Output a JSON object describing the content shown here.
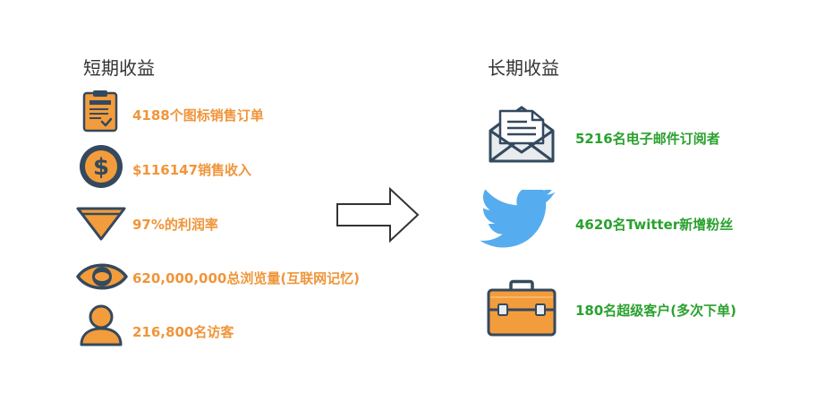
{
  "short_term": {
    "heading": "短期收益",
    "items": [
      {
        "icon": "clipboard-icon",
        "text": "4188个图标销售订单"
      },
      {
        "icon": "dollar-coin-icon",
        "text": "$116147销售收入"
      },
      {
        "icon": "triangle-icon",
        "text": "97%的利润率"
      },
      {
        "icon": "eye-icon",
        "text": "620,000,000总浏览量(互联网记忆)"
      },
      {
        "icon": "user-icon",
        "text": "216,800名访客"
      }
    ]
  },
  "long_term": {
    "heading": "长期收益",
    "items": [
      {
        "icon": "envelope-icon",
        "text": "5216名电子邮件订阅者"
      },
      {
        "icon": "twitter-bird-icon",
        "text": "4620名Twitter新增粉丝"
      },
      {
        "icon": "briefcase-icon",
        "text": "180名超级客户(多次下单)"
      }
    ]
  },
  "colors": {
    "short_text": "#f0953a",
    "long_text": "#2aa12e",
    "icon_orange": "#f39c3c",
    "twitter_blue": "#55acee",
    "outline": "#34495e"
  }
}
